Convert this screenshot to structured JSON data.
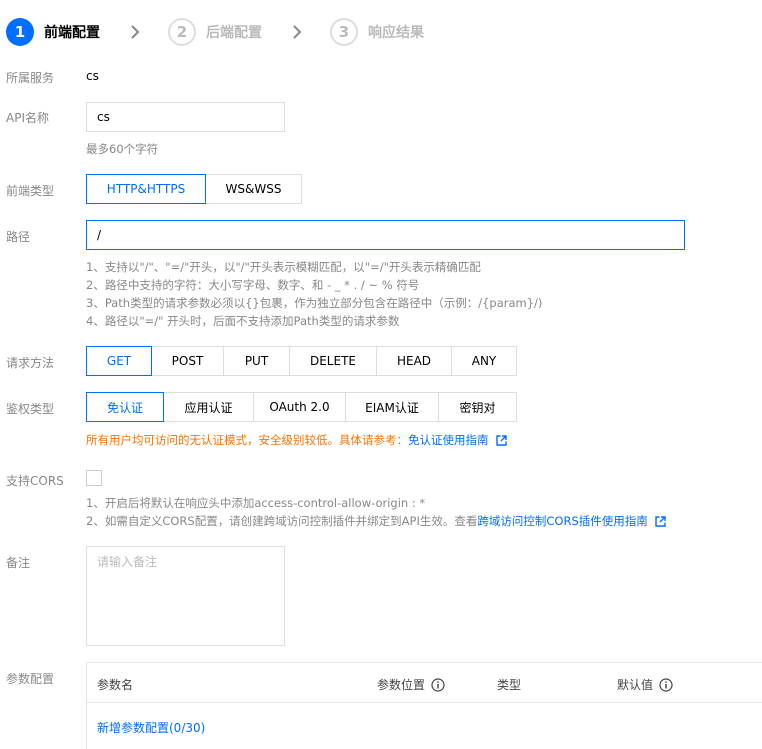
{
  "steps": [
    {
      "num": "1",
      "label": "前端配置"
    },
    {
      "num": "2",
      "label": "后端配置"
    },
    {
      "num": "3",
      "label": "响应结果"
    }
  ],
  "service": {
    "label": "所属服务",
    "value": "cs"
  },
  "api_name": {
    "label": "API名称",
    "value": "cs",
    "hint": "最多60个字符"
  },
  "frontend_type": {
    "label": "前端类型",
    "options": [
      "HTTP&HTTPS",
      "WS&WSS"
    ],
    "selected": "HTTP&HTTPS"
  },
  "path": {
    "label": "路径",
    "value": "/",
    "hints": [
      "1、支持以\"/\"、\"=/\"开头，以\"/\"开头表示模糊匹配，以\"=/\"开头表示精确匹配",
      "2、路径中支持的字符：大小写字母、数字、和 - _ * . / ~ % 符号",
      "3、Path类型的请求参数必须以{}包裹，作为独立部分包含在路径中（示例：/{param}/)",
      "4、路径以\"=/\" 开头时，后面不支持添加Path类型的请求参数"
    ]
  },
  "method": {
    "label": "请求方法",
    "options": [
      "GET",
      "POST",
      "PUT",
      "DELETE",
      "HEAD",
      "ANY"
    ],
    "selected": "GET"
  },
  "auth": {
    "label": "鉴权类型",
    "options": [
      "免认证",
      "应用认证",
      "OAuth 2.0",
      "EIAM认证",
      "密钥对"
    ],
    "selected": "免认证",
    "warning_prefix": "所有用户均可访问的无认证模式，安全级别较低。",
    "warning_mid": "具体请参考：",
    "warning_link": "免认证使用指南"
  },
  "cors": {
    "label": "支持CORS",
    "hint1": "1、开启后将默认在响应头中添加access-control-allow-origin : *",
    "hint2_prefix": "2、如需自定义CORS配置，请创建跨域访问控制插件并绑定到API生效。查看",
    "hint2_link": "跨域访问控制CORS插件使用指南"
  },
  "remark": {
    "label": "备注",
    "placeholder": "请输入备注"
  },
  "params": {
    "label": "参数配置",
    "columns": [
      "参数名",
      "参数位置",
      "类型",
      "默认值"
    ],
    "add_link": "新增参数配置(0/30)"
  },
  "colors": {
    "accent": "#006eff",
    "warning": "#ff7200",
    "danger": "#e54545"
  }
}
